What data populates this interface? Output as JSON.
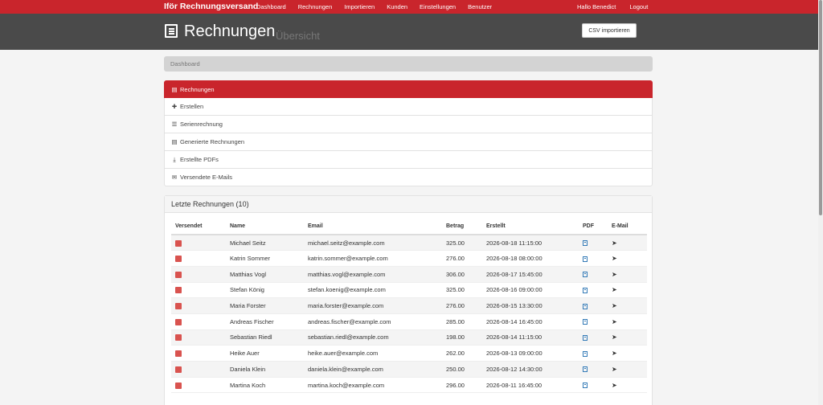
{
  "nav": {
    "brand": "Iför Rechnungsversand",
    "links": [
      "Dashboard",
      "Rechnungen",
      "Importieren",
      "Kunden",
      "Einstellungen",
      "Benutzer"
    ],
    "greeting": "Hallo Benedict",
    "logout": "Logout"
  },
  "header": {
    "title": "Rechnungen",
    "subtitle": "Übersicht",
    "csv_button": "CSV importieren"
  },
  "breadcrumb": "Dashboard",
  "menu": [
    {
      "label": "Rechnungen",
      "icon": "list-icon",
      "glyph": "▤"
    },
    {
      "label": "Erstellen",
      "icon": "plus-icon",
      "glyph": "✚"
    },
    {
      "label": "Serienrechnung",
      "icon": "list-bullets-icon",
      "glyph": "☰"
    },
    {
      "label": "Generierte Rechnungen",
      "icon": "document-list-icon",
      "glyph": "▤"
    },
    {
      "label": "Erstellte PDFs",
      "icon": "download-icon",
      "glyph": "⤓"
    },
    {
      "label": "Versendete E-Mails",
      "icon": "envelope-icon",
      "glyph": "✉"
    }
  ],
  "panel": {
    "title": "Letzte Rechnungen (10)",
    "columns": [
      "Versendet",
      "Name",
      "Email",
      "Betrag",
      "Erstellt",
      "PDF",
      "E-Mail"
    ],
    "rows": [
      {
        "name": "Michael Seitz",
        "email": "michael.seitz@example.com",
        "amount": "325.00",
        "created": "2026-08-18 11:15:00"
      },
      {
        "name": "Katrin Sommer",
        "email": "katrin.sommer@example.com",
        "amount": "276.00",
        "created": "2026-08-18 08:00:00"
      },
      {
        "name": "Matthias Vogl",
        "email": "matthias.vogl@example.com",
        "amount": "306.00",
        "created": "2026-08-17 15:45:00"
      },
      {
        "name": "Stefan König",
        "email": "stefan.koenig@example.com",
        "amount": "325.00",
        "created": "2026-08-16 09:00:00"
      },
      {
        "name": "Maria Forster",
        "email": "maria.forster@example.com",
        "amount": "276.00",
        "created": "2026-08-15 13:30:00"
      },
      {
        "name": "Andreas Fischer",
        "email": "andreas.fischer@example.com",
        "amount": "285.00",
        "created": "2026-08-14 16:45:00"
      },
      {
        "name": "Sebastian Riedl",
        "email": "sebastian.riedl@example.com",
        "amount": "198.00",
        "created": "2026-08-14 11:15:00"
      },
      {
        "name": "Heike Auer",
        "email": "heike.auer@example.com",
        "amount": "262.00",
        "created": "2026-08-13 09:00:00"
      },
      {
        "name": "Daniela Klein",
        "email": "daniela.klein@example.com",
        "amount": "250.00",
        "created": "2026-08-12 14:30:00"
      },
      {
        "name": "Martina Koch",
        "email": "martina.koch@example.com",
        "amount": "296.00",
        "created": "2026-08-11 16:45:00"
      }
    ]
  },
  "colors": {
    "accent": "#c9252c",
    "header_bg": "#4a4a4a",
    "status_not_sent": "#d9534f"
  }
}
